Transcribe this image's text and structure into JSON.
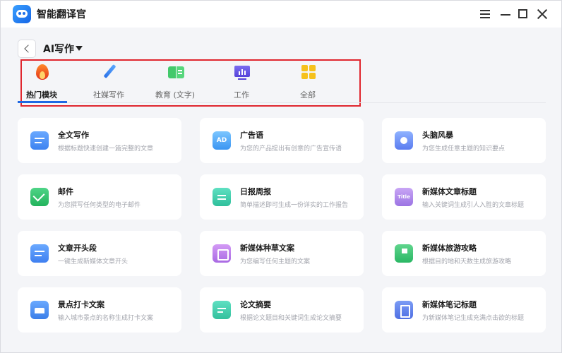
{
  "app": {
    "title": "智能翻译官"
  },
  "section": {
    "title": "AI写作"
  },
  "tabs": [
    {
      "label": "热门模块",
      "icon": "fire-icon",
      "active": true
    },
    {
      "label": "社媒写作",
      "icon": "pen-icon"
    },
    {
      "label": "教育 (文字)",
      "icon": "book-icon"
    },
    {
      "label": "工作",
      "icon": "monitor-icon"
    },
    {
      "label": "全部",
      "icon": "grid-icon"
    }
  ],
  "cards": [
    {
      "title": "全文写作",
      "desc": "根据标题快速创建一篇完整的文章",
      "icon": "document-icon"
    },
    {
      "title": "广告语",
      "desc": "为您的产品提出有创意的广告宣传语",
      "icon": "ad-icon",
      "icon_text": "AD"
    },
    {
      "title": "头脑风暴",
      "desc": "为您生成任意主题的知识要点",
      "icon": "brain-icon"
    },
    {
      "title": "邮件",
      "desc": "为您撰写任何类型的电子邮件",
      "icon": "mail-icon"
    },
    {
      "title": "日报周报",
      "desc": "简单描述即可生成一份详实的工作报告",
      "icon": "report-icon"
    },
    {
      "title": "新媒体文章标题",
      "desc": "输入关键词生成引人入胜的文章标题",
      "icon": "title-icon",
      "icon_text": "Title"
    },
    {
      "title": "文章开头段",
      "desc": "一键生成新媒体文章开头",
      "icon": "paragraph-icon"
    },
    {
      "title": "新媒体种草文案",
      "desc": "为您编写任何主题的文案",
      "icon": "seed-icon"
    },
    {
      "title": "新媒体旅游攻略",
      "desc": "根据目的地和天数生成旅游攻略",
      "icon": "travel-flag-icon"
    },
    {
      "title": "景点打卡文案",
      "desc": "输入城市景点的名称生成打卡文案",
      "icon": "landmark-icon"
    },
    {
      "title": "论文摘要",
      "desc": "根据论文题目和关键词生成论文摘要",
      "icon": "abstract-icon"
    },
    {
      "title": "新媒体笔记标题",
      "desc": "为新媒体笔记生成充满点击欲的标题",
      "icon": "notebook-icon"
    }
  ],
  "colors": {
    "accent": "#1f68e3",
    "highlight_frame": "#e0262e",
    "background": "#f4f5f8"
  }
}
